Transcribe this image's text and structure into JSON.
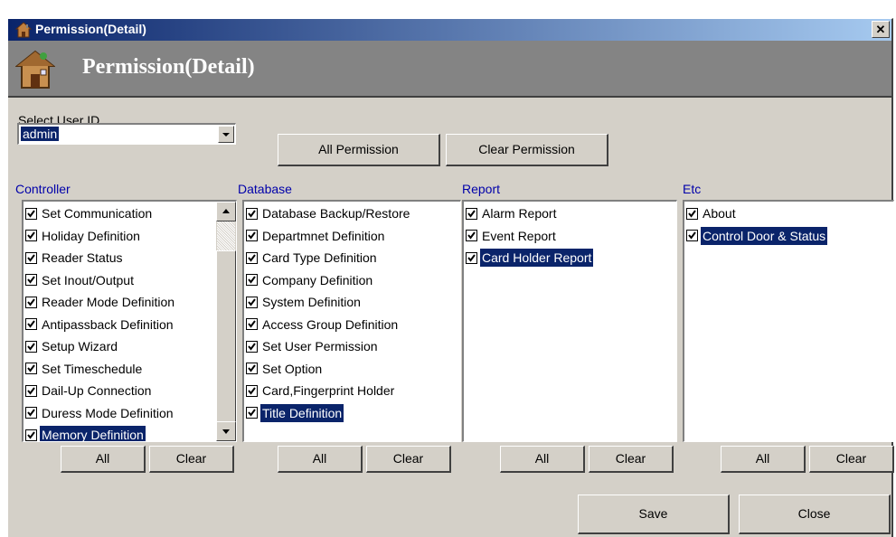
{
  "window": {
    "title": "Permission(Detail)",
    "banner_title": "Permission(Detail)",
    "close_glyph": "✕"
  },
  "user": {
    "label": "Select User ID",
    "selected": "admin"
  },
  "buttons": {
    "all_permission": "All Permission",
    "clear_permission": "Clear Permission",
    "all": "All",
    "clear": "Clear",
    "save": "Save",
    "close": "Close"
  },
  "sections": [
    {
      "label": "Controller",
      "items": [
        {
          "text": "Set Communication",
          "checked": true,
          "selected": false
        },
        {
          "text": "Holiday Definition",
          "checked": true,
          "selected": false
        },
        {
          "text": "Reader Status",
          "checked": true,
          "selected": false
        },
        {
          "text": "Set Inout/Output",
          "checked": true,
          "selected": false
        },
        {
          "text": "Reader Mode Definition",
          "checked": true,
          "selected": false
        },
        {
          "text": "Antipassback Definition",
          "checked": true,
          "selected": false
        },
        {
          "text": "Setup Wizard",
          "checked": true,
          "selected": false
        },
        {
          "text": "Set Timeschedule",
          "checked": true,
          "selected": false
        },
        {
          "text": "Dail-Up Connection",
          "checked": true,
          "selected": false
        },
        {
          "text": "Duress Mode Definition",
          "checked": true,
          "selected": false
        },
        {
          "text": "Memory Definition",
          "checked": true,
          "selected": true
        }
      ]
    },
    {
      "label": "Database",
      "items": [
        {
          "text": "Database Backup/Restore",
          "checked": true,
          "selected": false
        },
        {
          "text": "Departmnet Definition",
          "checked": true,
          "selected": false
        },
        {
          "text": "Card Type Definition",
          "checked": true,
          "selected": false
        },
        {
          "text": "Company Definition",
          "checked": true,
          "selected": false
        },
        {
          "text": "System Definition",
          "checked": true,
          "selected": false
        },
        {
          "text": "Access Group Definition",
          "checked": true,
          "selected": false
        },
        {
          "text": "Set User Permission",
          "checked": true,
          "selected": false
        },
        {
          "text": "Set Option",
          "checked": true,
          "selected": false
        },
        {
          "text": "Card,Fingerprint Holder",
          "checked": true,
          "selected": false
        },
        {
          "text": "Title Definition",
          "checked": true,
          "selected": true
        }
      ]
    },
    {
      "label": "Report",
      "items": [
        {
          "text": "Alarm Report",
          "checked": true,
          "selected": false
        },
        {
          "text": "Event Report",
          "checked": true,
          "selected": false
        },
        {
          "text": "Card Holder Report",
          "checked": true,
          "selected": true
        }
      ]
    },
    {
      "label": "Etc",
      "items": [
        {
          "text": "About",
          "checked": true,
          "selected": false
        },
        {
          "text": "Control Door & Status",
          "checked": true,
          "selected": true
        }
      ]
    }
  ],
  "icons": {
    "app": "house-icon",
    "checkbox": "check-icon",
    "scroll_up": "arrow-up-icon",
    "scroll_down": "arrow-down-icon",
    "dropdown": "chevron-down-icon"
  },
  "colors": {
    "titlebar_start": "#0a246a",
    "titlebar_end": "#a6caf0",
    "selection": "#0a246a",
    "section_label": "#0000aa",
    "banner": "#848484",
    "face": "#d4d0c8"
  }
}
